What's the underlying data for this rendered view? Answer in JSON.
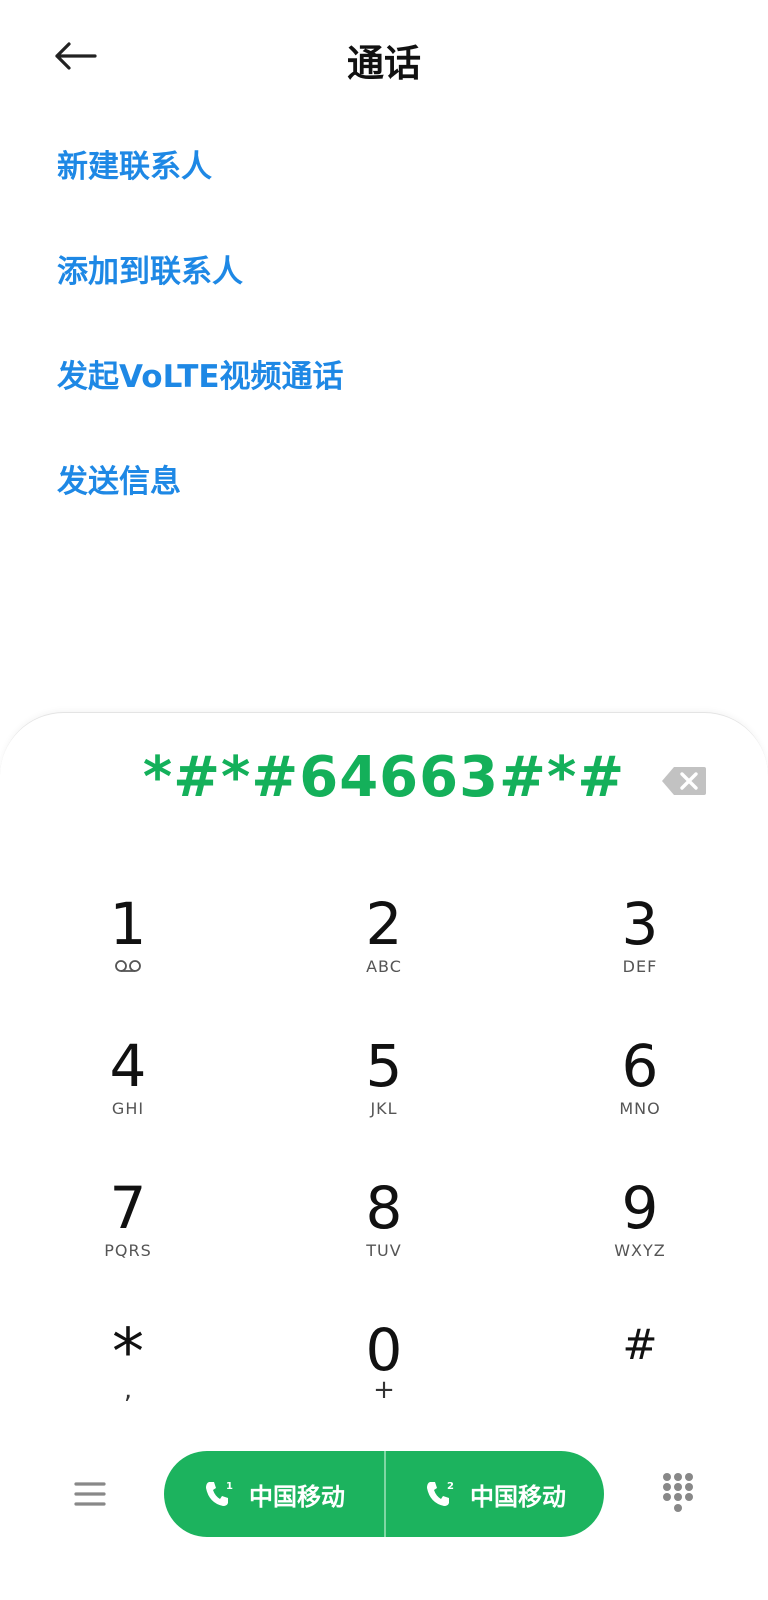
{
  "header": {
    "title": "通话",
    "back_icon": "arrow-left-icon"
  },
  "menu": {
    "items": [
      {
        "label": "新建联系人"
      },
      {
        "label": "添加到联系人"
      },
      {
        "label": "发起VoLTE视频通话"
      },
      {
        "label": "发送信息"
      }
    ]
  },
  "dialpad": {
    "number": "*#*#64663#*#",
    "backspace_icon": "backspace-icon",
    "keys": [
      {
        "digit": "1",
        "letters": "",
        "sub_icon": "voicemail-icon"
      },
      {
        "digit": "2",
        "letters": "ABC"
      },
      {
        "digit": "3",
        "letters": "DEF"
      },
      {
        "digit": "4",
        "letters": "GHI"
      },
      {
        "digit": "5",
        "letters": "JKL"
      },
      {
        "digit": "6",
        "letters": "MNO"
      },
      {
        "digit": "7",
        "letters": "PQRS"
      },
      {
        "digit": "8",
        "letters": "TUV"
      },
      {
        "digit": "9",
        "letters": "WXYZ"
      },
      {
        "digit": "*",
        "letters": ","
      },
      {
        "digit": "0",
        "letters": "+"
      },
      {
        "digit": "#",
        "letters": ""
      }
    ]
  },
  "bottom_bar": {
    "menu_icon": "hamburger-menu-icon",
    "sim1_label": "中国移动",
    "sim1_icon": "phone-sim1-icon",
    "sim2_label": "中国移动",
    "sim2_icon": "phone-sim2-icon",
    "dialpad_toggle_icon": "dialpad-grid-icon"
  },
  "colors": {
    "link_blue": "#1e88e5",
    "dial_green": "#14b05a",
    "call_green": "#1cb35e"
  }
}
